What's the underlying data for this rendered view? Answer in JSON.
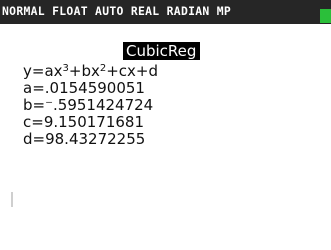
{
  "status": {
    "mode_text": "NORMAL FLOAT AUTO REAL RADIAN MP",
    "battery_color": "#2bbf3a"
  },
  "result": {
    "title": "CubicReg",
    "equation": {
      "prefix": "y=ax",
      "exp1": "3",
      "middle": "+bx",
      "exp2": "2",
      "suffix": "+cx+d"
    },
    "coefficients": [
      "a=.0154590051",
      "b=⁻.5951424724",
      "c=9.150171681",
      "d=98.43272255"
    ]
  }
}
